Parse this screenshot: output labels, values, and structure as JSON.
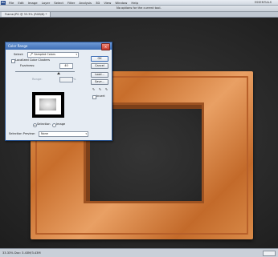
{
  "menubar": {
    "logo": "Ps",
    "items": [
      "File",
      "Edit",
      "Image",
      "Layer",
      "Select",
      "Filter",
      "Analysis",
      "3D",
      "View",
      "Window",
      "Help"
    ],
    "workspace": "ESSENTIALS"
  },
  "options_bar": {
    "hint": "No options for the current tool."
  },
  "document": {
    "tab": "Frame.JPG @ 33.3% (RGB/8) *"
  },
  "status": {
    "zoom": "33.33%",
    "doc": "Doc: 3.43M/3.43M"
  },
  "dialog": {
    "title": "Color Range",
    "select_label": "Select:",
    "select_value": "Sampled Colors",
    "localized_label": "Localized Color Clusters",
    "fuzziness_label": "Fuzziness:",
    "fuzziness_value": "40",
    "range_label": "Range:",
    "range_unit": "%",
    "buttons": {
      "ok": "OK",
      "cancel": "Cancel",
      "load": "Load...",
      "save": "Save..."
    },
    "invert_label": "Invert",
    "radio_selection": "Selection",
    "radio_image": "Image",
    "preview_label": "Selection Preview:",
    "preview_value": "None"
  }
}
